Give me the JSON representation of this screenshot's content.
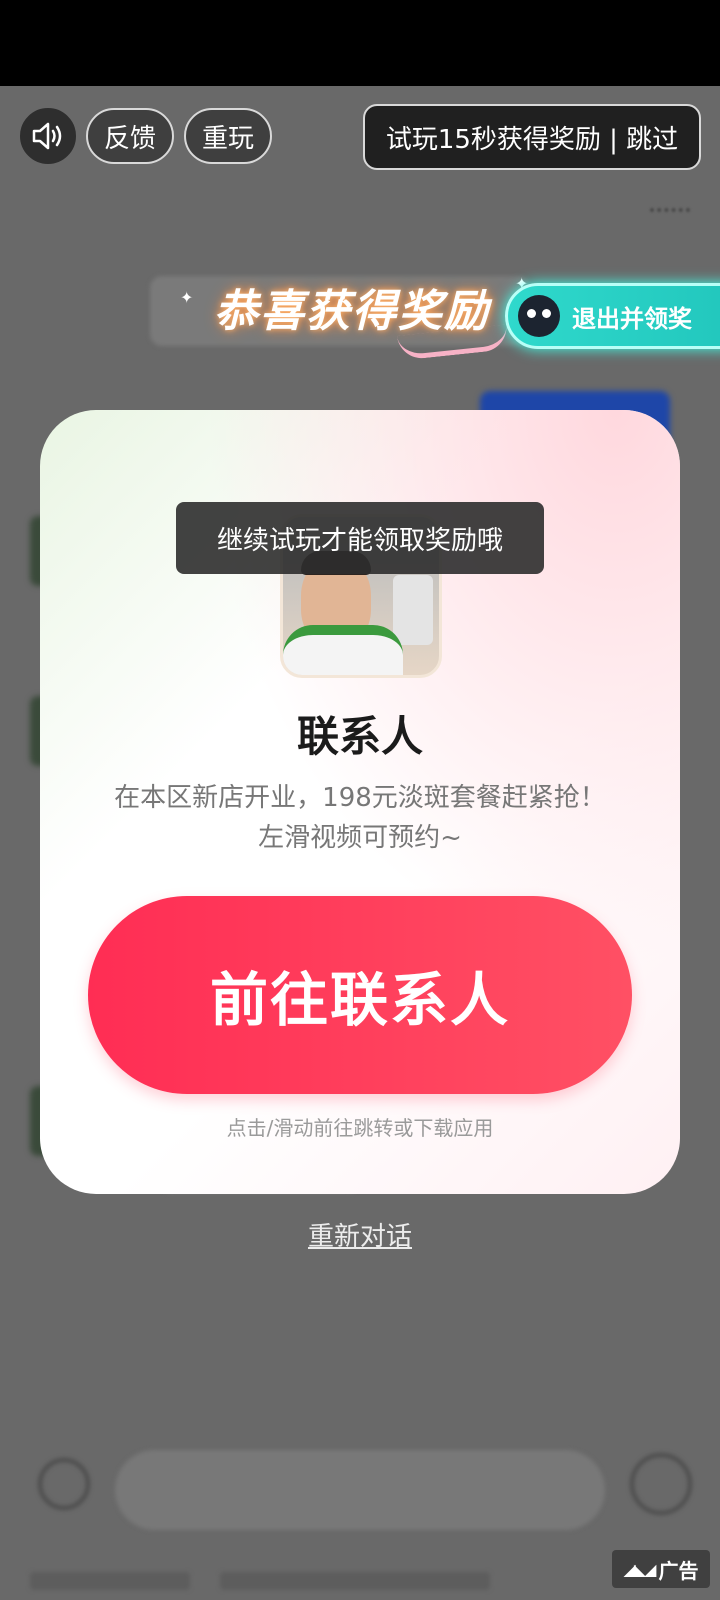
{
  "top_controls": {
    "sound_icon": "speaker-icon",
    "feedback_label": "反馈",
    "replay_label": "重玩",
    "skip_label": "试玩15秒获得奖励 | 跳过"
  },
  "reward_banner": {
    "title": "恭喜获得奖励",
    "exit_claim_label": "退出并领奖"
  },
  "modal": {
    "title": "联系人",
    "description": "在本区新店开业，198元淡斑套餐赶紧抢！左滑视频可预约~",
    "cta_label": "前往联系人",
    "hint": "点击/滑动前往跳转或下载应用"
  },
  "toast": "继续试玩才能领取奖励哦",
  "restart_label": "重新对话",
  "ad_badge": {
    "label": "广告"
  },
  "colors": {
    "cta": "#ff3358",
    "exit_claim": "#2fd9cc"
  }
}
